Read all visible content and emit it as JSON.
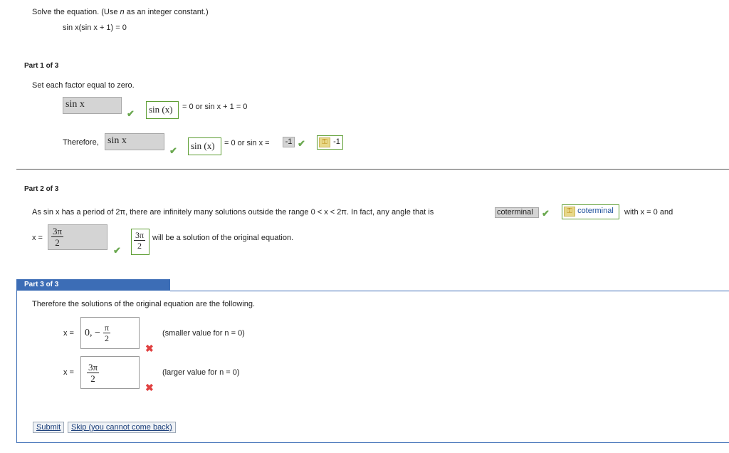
{
  "problem": {
    "instruction": "Solve the equation. (Use n as an integer constant.)",
    "instruction_parts": [
      "Solve the equation. (Use ",
      "n",
      " as an integer constant.)"
    ],
    "equation": "sin x(sin x + 1) = 0"
  },
  "part1": {
    "header": "Part 1 of 3",
    "instruction": "Set each factor equal to zero.",
    "row1": {
      "input_value": "sin x",
      "answer_value": "sin (x)",
      "tail": "= 0 or sin x + 1 = 0"
    },
    "row2": {
      "prefix": "Therefore,",
      "input_value": "sin x",
      "answer_value": "sin (x)",
      "middle": "= 0 or sin x =",
      "input2_value": "-1",
      "answer2_value": "-1"
    }
  },
  "part2": {
    "header": "Part 2 of 3",
    "sentence_start": "As sin x has a period of 2π, there are infinitely many solutions outside the range 0 < x < 2π. In fact, any angle that is",
    "input_value": "coterminal",
    "answer_value": "coterminal",
    "sentence_end": "with x = 0 and",
    "x_label": "x =",
    "frac_input": {
      "num": "3π",
      "den": "2"
    },
    "frac_answer": {
      "num": "3π",
      "den": "2"
    },
    "tail": "will be a solution of the original equation."
  },
  "part3": {
    "header": "Part 3 of 3",
    "instruction": "Therefore the solutions of the original equation are the following.",
    "row1": {
      "x_label": "x =",
      "value_prefix": "0, −",
      "frac": {
        "num": "π",
        "den": "2"
      },
      "note": "(smaller value for n = 0)"
    },
    "row2": {
      "x_label": "x =",
      "frac": {
        "num": "3π",
        "den": "2"
      },
      "note": "(larger value for n = 0)"
    },
    "submit_label": "Submit",
    "skip_label": "Skip (you cannot come back)"
  },
  "icons": {
    "correct": "check-icon",
    "incorrect": "x-icon",
    "answer_key": "key-icon"
  },
  "colors": {
    "part3_header_bg": "#3c6db6",
    "correct_green": "#6aa84f",
    "incorrect_red": "#e04040",
    "answer_border": "#5e9e34",
    "input_grey": "#d4d4d4"
  }
}
